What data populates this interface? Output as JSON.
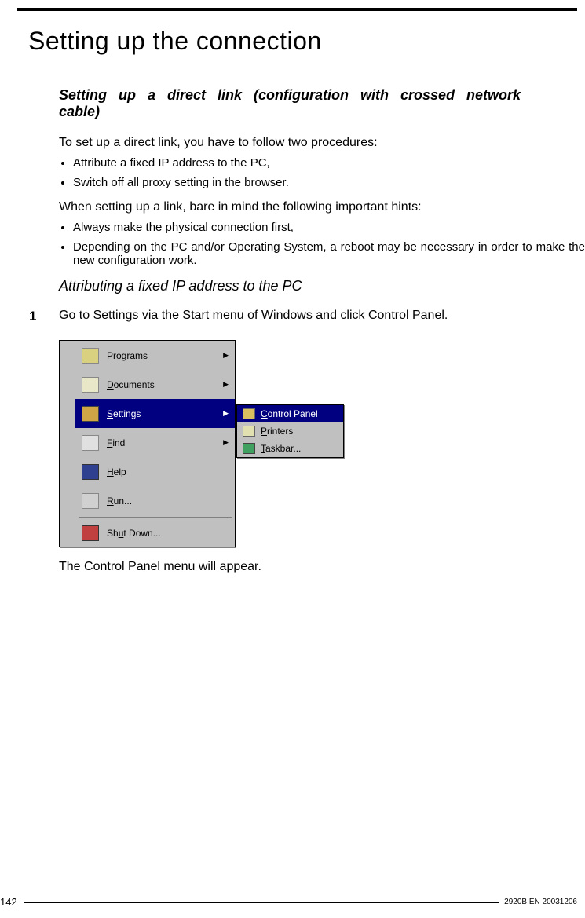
{
  "title": "Setting up the connection",
  "subhead_line1": "Setting up a direct link (configuration with crossed network",
  "subhead_line2": "cable)",
  "intro": "To set up a direct link, you have to follow two procedures:",
  "proc_bullets": [
    "Attribute a fixed IP address to the PC,",
    "Switch off all proxy setting in the browser."
  ],
  "hints_intro": "When setting up a link, bare in mind the following important hints:",
  "hints_bullets": [
    "Always make the physical connection first,",
    "Depending on the PC and/or Operating System, a reboot may be necessary in order to make the new configuration work."
  ],
  "subsubhead": "Attributing a fixed IP address to the PC",
  "step1_num": "1",
  "step1_text": "Go to Settings via the Start menu of Windows and click Control Panel.",
  "start_menu": {
    "items": [
      {
        "label_u": "P",
        "label": "rograms",
        "arrow": true,
        "sel": false,
        "icon": "i-prog"
      },
      {
        "label_u": "D",
        "label": "ocuments",
        "arrow": true,
        "sel": false,
        "icon": "i-doc"
      },
      {
        "label_u": "S",
        "label": "ettings",
        "arrow": true,
        "sel": true,
        "icon": "i-set"
      },
      {
        "label_u": "F",
        "label": "ind",
        "arrow": true,
        "sel": false,
        "icon": "i-find"
      },
      {
        "label_u": "H",
        "label": "elp",
        "arrow": false,
        "sel": false,
        "icon": "i-help"
      },
      {
        "label_u": "R",
        "label": "un...",
        "arrow": false,
        "sel": false,
        "icon": "i-run"
      }
    ],
    "shutdown": {
      "label_u": "u",
      "label_before": "Sh",
      "label_after": "t Down...",
      "icon": "i-shut"
    },
    "submenu": [
      {
        "label_u": "C",
        "label": "ontrol Panel",
        "sel": true,
        "icon": "i-cp"
      },
      {
        "label_u": "P",
        "label": "rinters",
        "sel": false,
        "icon": "i-prn"
      },
      {
        "label_u": "T",
        "label": "askbar...",
        "sel": false,
        "icon": "i-tb"
      }
    ]
  },
  "after_menu": "The Control Panel menu will appear.",
  "page_number": "142",
  "doc_id": "2920B EN 20031206"
}
